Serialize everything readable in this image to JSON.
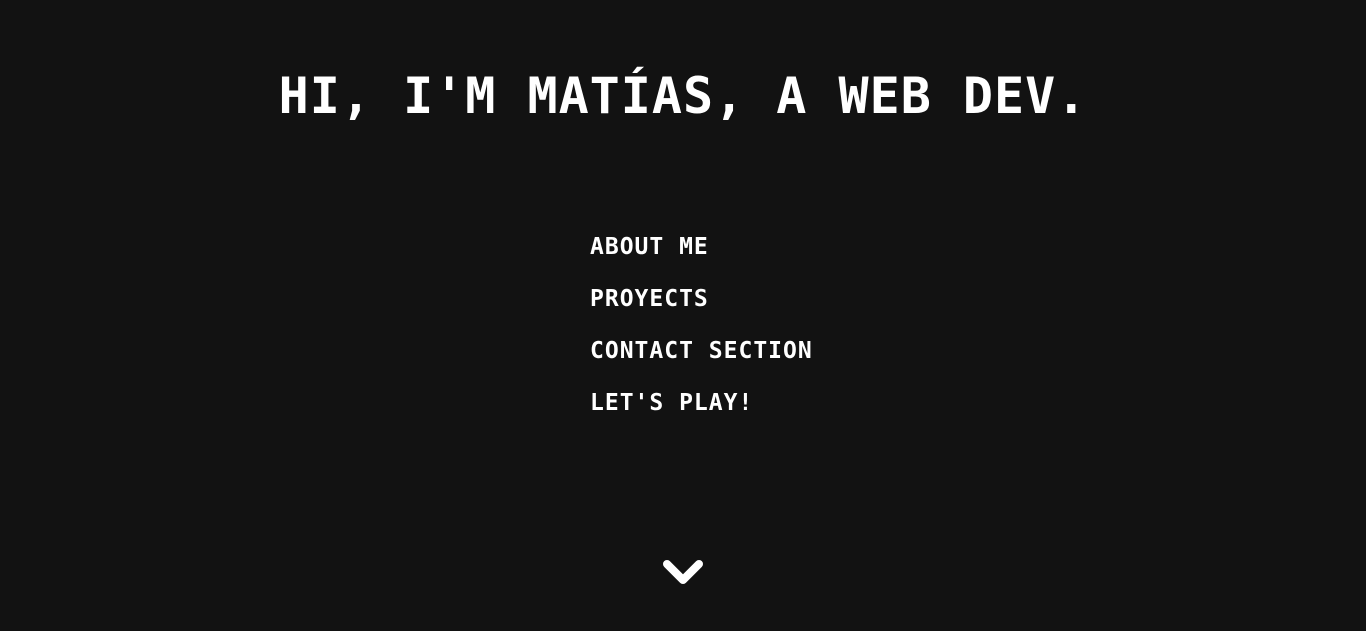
{
  "hero": {
    "title": "Hi, I'm Matías, a web dev."
  },
  "nav": {
    "items": [
      {
        "label": "About me"
      },
      {
        "label": "Proyects"
      },
      {
        "label": "Contact section"
      },
      {
        "label": "Let's play!"
      }
    ]
  },
  "scroll_indicator": {
    "icon": "chevron-down-icon"
  },
  "colors": {
    "background": "#121212",
    "text": "#ffffff"
  }
}
